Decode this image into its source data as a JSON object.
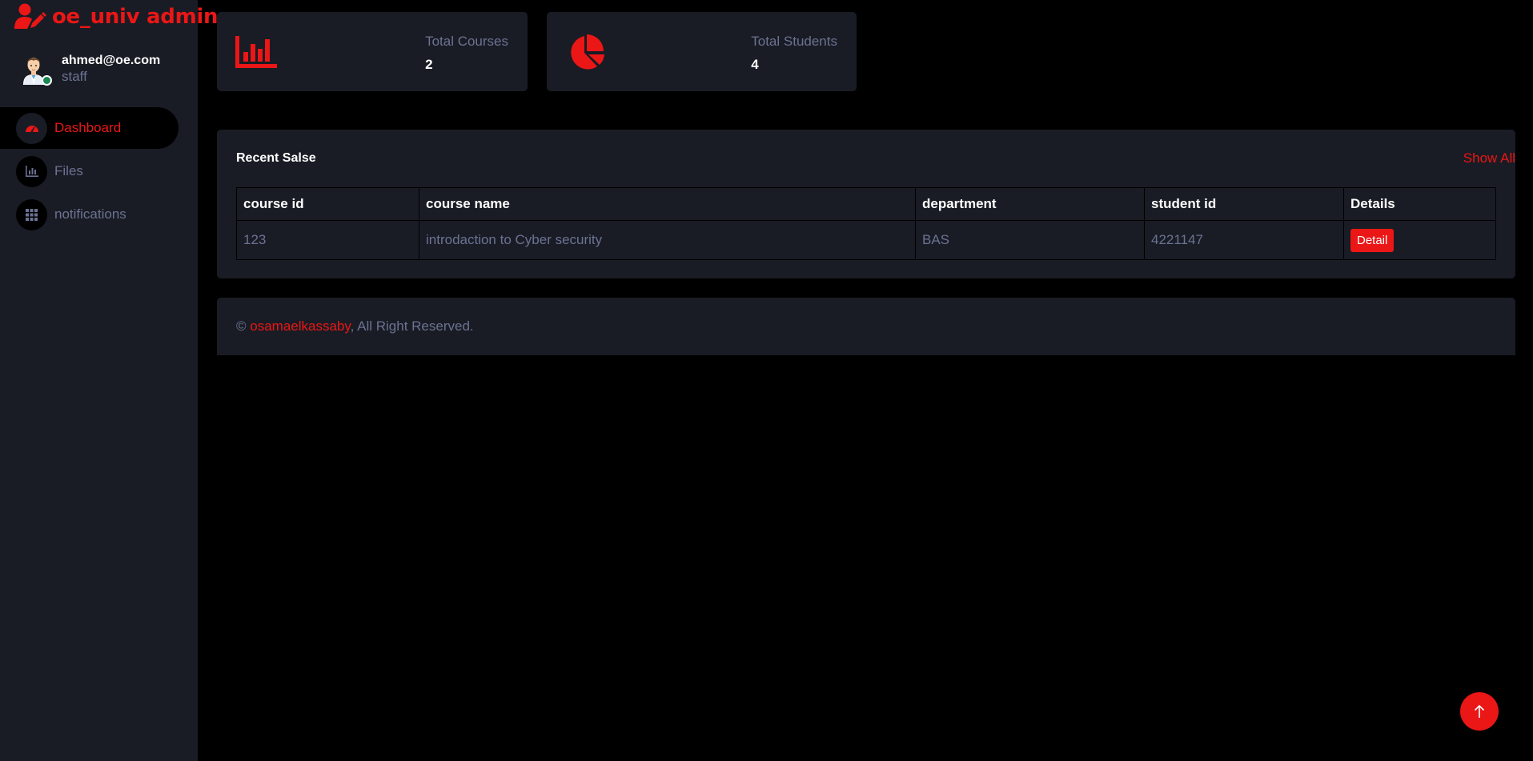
{
  "brand": {
    "name": "oe_univ admin",
    "icon": "user-edit-icon"
  },
  "profile": {
    "email": "ahmed@oe.com",
    "role": "staff",
    "status": "online"
  },
  "nav": [
    {
      "label": "Dashboard",
      "icon": "gauge-icon",
      "active": true
    },
    {
      "label": "Files",
      "icon": "bar-chart-icon",
      "active": false
    },
    {
      "label": "notifications",
      "icon": "grid-icon",
      "active": false
    }
  ],
  "stats": [
    {
      "label": "Total Courses",
      "value": "2",
      "icon": "chart-bar-icon"
    },
    {
      "label": "Total Students",
      "value": "4",
      "icon": "pie-chart-icon"
    }
  ],
  "recent": {
    "title": "Recent Salse",
    "show_all": "Show All",
    "columns": [
      "course id",
      "course name",
      "department",
      "student id",
      "Details"
    ],
    "rows": [
      {
        "course_id": "123",
        "course_name": "introdaction to Cyber security",
        "department": "BAS",
        "student_id": "4221147",
        "action": "Detail"
      }
    ]
  },
  "footer": {
    "copyright": "©",
    "owner": "osamaelkassaby",
    "rights": ", All Right Reserved."
  },
  "colors": {
    "accent": "#eb1616",
    "panel": "#191c24",
    "muted": "#6c7293",
    "background": "#000000"
  }
}
